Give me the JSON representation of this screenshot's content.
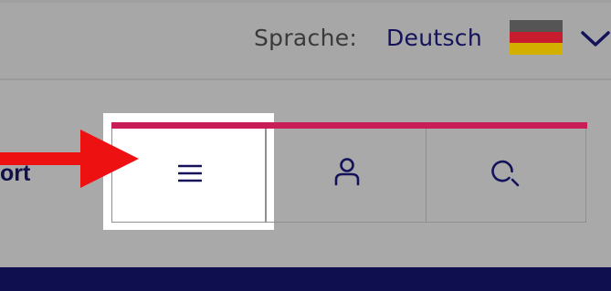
{
  "language": {
    "label": "Sprache:",
    "value": "Deutsch",
    "flag_icon": "germany-flag-icon",
    "flag_colors": [
      "#555555",
      "#c81d2e",
      "#d3b000"
    ],
    "dropdown_icon": "chevron-down-icon"
  },
  "nav": {
    "support_label": "ort",
    "tabs": [
      {
        "name": "menu",
        "icon": "hamburger-menu-icon"
      },
      {
        "name": "account",
        "icon": "user-icon"
      },
      {
        "name": "search",
        "icon": "search-icon"
      }
    ],
    "accent_color": "#c81d56"
  },
  "annotation": {
    "arrow_color": "#ee1111"
  },
  "colors": {
    "brand_dark": "#13125a",
    "footer": "#0f0f4f"
  }
}
